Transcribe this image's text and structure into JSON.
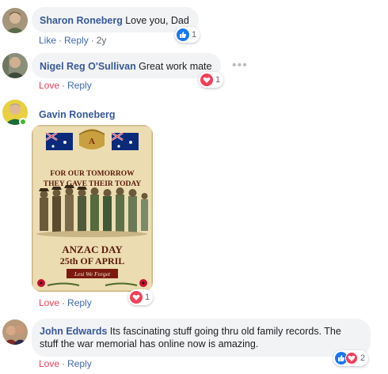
{
  "comments": [
    {
      "author": "Sharon Roneberg",
      "text": "Love you, Dad",
      "actions": {
        "like": "Like",
        "reply": "Reply",
        "time": "2y"
      },
      "reaction": {
        "type": "like",
        "count": "1"
      }
    },
    {
      "author": "Nigel Reg O'Sullivan",
      "text": "Great work mate",
      "actions": {
        "like": "Love",
        "reply": "Reply"
      },
      "reaction": {
        "type": "heart",
        "count": "1"
      }
    },
    {
      "author": "Gavin Roneberg",
      "actions": {
        "like": "Love",
        "reply": "Reply"
      },
      "reaction": {
        "type": "heart",
        "count": "1"
      },
      "image": {
        "line1": "FOR OUR TOMORROW",
        "line2": "THEY GAVE THEIR TODAY",
        "title": "ANZAC DAY",
        "date": "25th OF APRIL",
        "banner": "Lest We Forget"
      }
    },
    {
      "author": "John Edwards",
      "text": "Its fascinating stuff going thru old family records. The stuff the war memorial has online now is amazing.",
      "actions": {
        "like": "Love",
        "reply": "Reply"
      },
      "reaction": {
        "types": [
          "like",
          "heart"
        ],
        "count": "2"
      }
    }
  ],
  "colors": {
    "author": "#385898",
    "like_link": "#4267b2",
    "love": "#f33e58",
    "bubble": "#f2f3f5",
    "online": "#42b72a"
  }
}
